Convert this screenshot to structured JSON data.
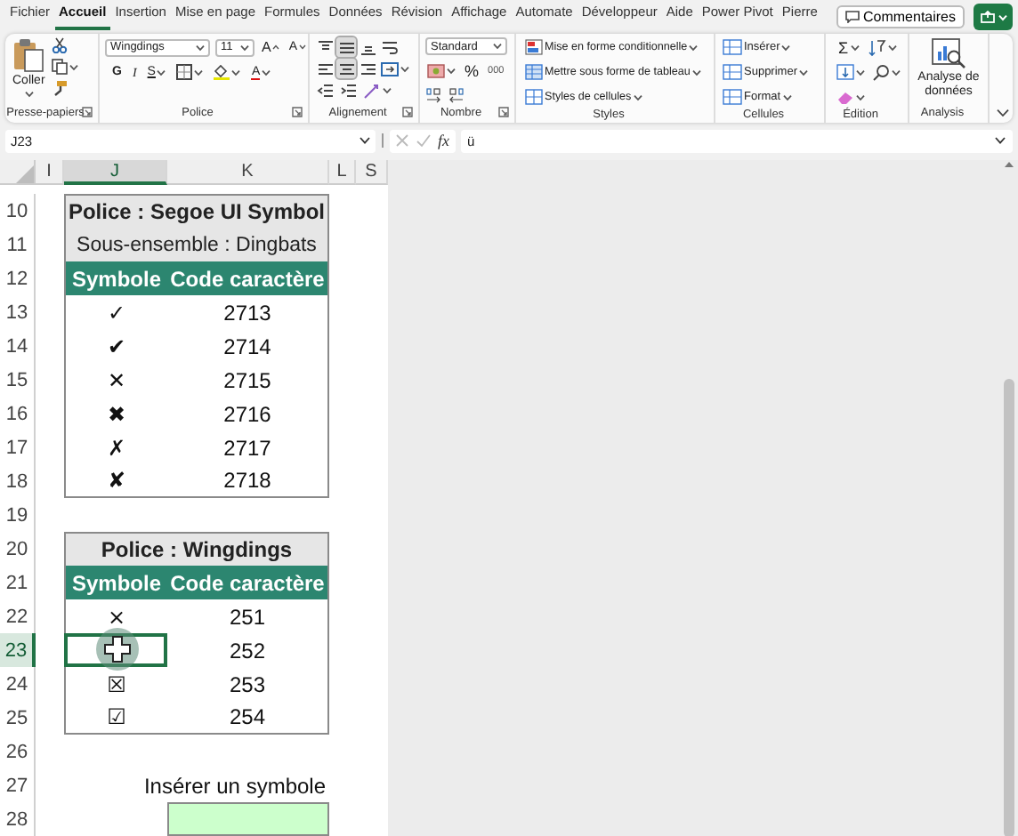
{
  "menu_tabs": [
    {
      "label": "Fichier",
      "selected": false
    },
    {
      "label": "Accueil",
      "selected": true
    },
    {
      "label": "Insertion",
      "selected": false
    },
    {
      "label": "Mise en page",
      "selected": false
    },
    {
      "label": "Formules",
      "selected": false
    },
    {
      "label": "Données",
      "selected": false
    },
    {
      "label": "Révision",
      "selected": false
    },
    {
      "label": "Affichage",
      "selected": false
    },
    {
      "label": "Automate",
      "selected": false
    },
    {
      "label": "Développeur",
      "selected": false
    },
    {
      "label": "Aide",
      "selected": false
    },
    {
      "label": "Power Pivot",
      "selected": false
    },
    {
      "label": "Pierre",
      "selected": false
    }
  ],
  "comments_button": "Commentaires",
  "ribbon": {
    "groups": [
      {
        "kind": "clipboard",
        "label": "Presse-papiers",
        "paste": "Coller"
      },
      {
        "kind": "font",
        "label": "Police",
        "font_name": "Wingdings",
        "font_size": "11",
        "grow": "A",
        "shrink": "A",
        "bold": "G",
        "italic": "I",
        "underline": "S",
        "font_color": "A"
      },
      {
        "kind": "alignment",
        "label": "Alignement",
        "vertical_buttons": [
          {
            "selected": false
          },
          {
            "selected": true
          },
          {
            "selected": false
          }
        ],
        "horizontal_buttons": [
          {
            "selected": false
          },
          {
            "selected": true
          },
          {
            "selected": false
          }
        ]
      },
      {
        "kind": "number",
        "label": "Nombre",
        "format": "Standard",
        "percent": "%",
        "thousands": "000"
      },
      {
        "kind": "styles",
        "label": "Styles",
        "items": [
          "Mise en forme conditionnelle",
          "Mettre sous forme de tableau",
          "Styles de cellules"
        ]
      },
      {
        "kind": "cells",
        "label": "Cellules",
        "items": [
          "Insérer",
          "Supprimer",
          "Format"
        ]
      },
      {
        "kind": "editing",
        "label": "Édition",
        "sum": "Σ"
      },
      {
        "kind": "analysis",
        "label": "Analysis",
        "button": "Analyse de données"
      }
    ]
  },
  "formula_bar": {
    "name_box": "J23",
    "fx": "fx",
    "formula": "ü"
  },
  "sheet": {
    "columns": [
      {
        "label": "I",
        "selected": false
      },
      {
        "label": "J",
        "selected": true
      },
      {
        "label": "K",
        "selected": false
      },
      {
        "label": "L",
        "selected": false
      },
      {
        "label": "S",
        "selected": false
      }
    ],
    "rows": [
      {
        "number": "10",
        "kind": "title",
        "text": "Police : Segoe UI Symbol"
      },
      {
        "number": "11",
        "kind": "subtitle",
        "text": "Sous-ensemble : Dingbats"
      },
      {
        "number": "12",
        "kind": "header",
        "symbol": "Symbole",
        "code": "Code caractère"
      },
      {
        "number": "13",
        "kind": "data",
        "symbol": "✓",
        "code": "2713",
        "selected": false
      },
      {
        "number": "14",
        "kind": "data",
        "symbol": "✔",
        "code": "2714",
        "selected": false
      },
      {
        "number": "15",
        "kind": "data",
        "symbol": "✕",
        "code": "2715",
        "selected": false
      },
      {
        "number": "16",
        "kind": "data",
        "symbol": "✖",
        "code": "2716",
        "selected": false
      },
      {
        "number": "17",
        "kind": "data",
        "symbol": "✗",
        "code": "2717",
        "selected": false
      },
      {
        "number": "18",
        "kind": "data",
        "symbol": "✘",
        "code": "2718",
        "selected": false
      },
      {
        "number": "19",
        "kind": "blank"
      },
      {
        "number": "20",
        "kind": "title",
        "text": "Police : Wingdings"
      },
      {
        "number": "21",
        "kind": "header",
        "symbol": "Symbole",
        "code": "Code caractère"
      },
      {
        "number": "22",
        "kind": "data",
        "symbol": "×",
        "code": "251",
        "selected": false
      },
      {
        "number": "23",
        "kind": "data",
        "code": "252",
        "selected": true
      },
      {
        "number": "24",
        "kind": "data",
        "symbol": "☒",
        "code": "253",
        "selected": false
      },
      {
        "number": "25",
        "kind": "data",
        "symbol": "☑",
        "code": "254",
        "selected": false
      },
      {
        "number": "26",
        "kind": "blank"
      },
      {
        "number": "27",
        "kind": "label",
        "text": "Insérer un symbole"
      },
      {
        "number": "28",
        "kind": "input"
      }
    ]
  }
}
